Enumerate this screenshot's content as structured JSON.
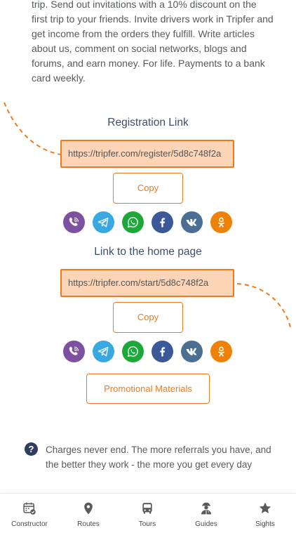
{
  "intro_text": "trip. Send out invitations with a 10% discount on the first trip to your friends. Invite drivers work in Tripfer and get income from the orders they fulfill. Write articles about us, comment on social networks, blogs and forums, and earn money. For life. Payments to a bank card weekly.",
  "registration": {
    "title": "Registration Link",
    "url": "https://tripfer.com/register/5d8c748f2a",
    "copy_label": "Copy"
  },
  "home": {
    "title": "Link to the home page",
    "url": "https://tripfer.com/start/5d8c748f2a",
    "copy_label": "Copy"
  },
  "share_icons": [
    {
      "name": "viber-icon",
      "color": "#7d519f"
    },
    {
      "name": "telegram-icon",
      "color": "#3aa8e0"
    },
    {
      "name": "whatsapp-icon",
      "color": "#1fa83a"
    },
    {
      "name": "facebook-icon",
      "color": "#3b5998"
    },
    {
      "name": "vk-icon",
      "color": "#4a6f93"
    },
    {
      "name": "odnoklassniki-icon",
      "color": "#ee8208"
    }
  ],
  "promo_label": "Promotional Materials",
  "note": {
    "icon": "?",
    "text": "Charges never end. The more referrals you have, and the better they work - the more you get every day"
  },
  "nav": [
    {
      "label": "Constructor",
      "icon": "calendar-icon"
    },
    {
      "label": "Routes",
      "icon": "map-pin-icon"
    },
    {
      "label": "Tours",
      "icon": "bus-icon"
    },
    {
      "label": "Guides",
      "icon": "guide-icon"
    },
    {
      "label": "Sights",
      "icon": "star-icon"
    }
  ],
  "accent_color": "#ee7a1f",
  "link_bg_color": "#fdd4b6"
}
